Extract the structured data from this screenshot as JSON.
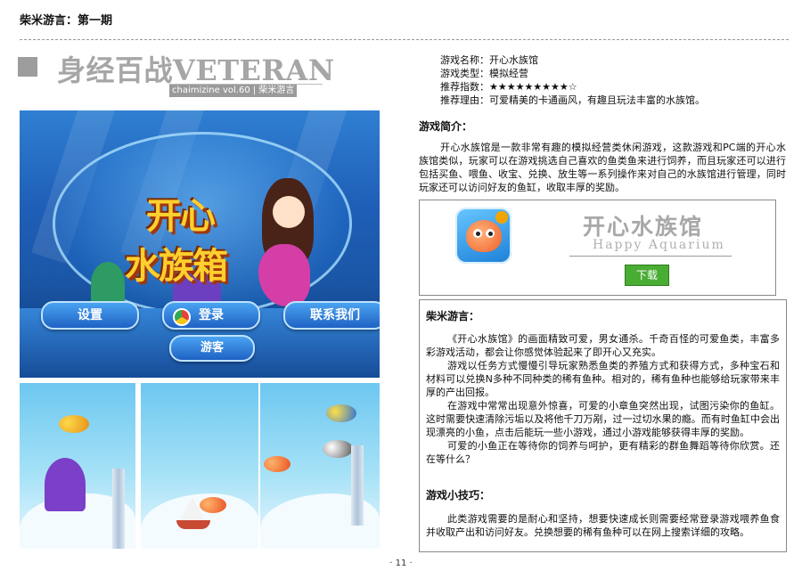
{
  "header": {
    "title": "柴米游言：第一期"
  },
  "column": {
    "title": "身经百战VETERAN",
    "subtitle": "chaimizine vol.60 | 柴米游言"
  },
  "game_info": {
    "name": "游戏名称：开心水族馆",
    "type": "游戏类型：模拟经营",
    "rating": "推荐指数：★★★★★★★★★☆",
    "reason": "推荐理由：可爱精美的卡通画风，有趣且玩法丰富的水族馆。"
  },
  "intro": {
    "heading": "游戏简介：",
    "text": "开心水族馆是一款非常有趣的模拟经营类休闲游戏，这款游戏和PC端的开心水族馆类似，玩家可以在游戏挑选自己喜欢的鱼类鱼来进行饲养，而且玩家还可以进行包括买鱼、喂鱼、收宝、兑换、放生等一系列操作来对自己的水族馆进行管理，同时玩家还可以访问好友的鱼缸，收取丰厚的奖励。"
  },
  "app_card": {
    "icon": "clownfish-app-icon",
    "title": "开心水族馆",
    "subtitle": "Happy  Aquarium",
    "download_label": "下载",
    "download_color": "#49ad34"
  },
  "review": {
    "heading": "柴米游言：",
    "paragraphs": [
      "《开心水族馆》的画面精致可爱，男女通杀。千奇百怪的可爱鱼类，丰富多彩游戏活动，都会让你感觉体验起来了即开心又充实。",
      "游戏以任务方式慢慢引导玩家熟悉鱼类的养殖方式和获得方式，多种宝石和材料可以兑换N多种不同种类的稀有鱼种。相对的，稀有鱼种也能够给玩家带来丰厚的产出回报。",
      "在游戏中常常出现意外惊喜，可爱的小章鱼突然出现，试图污染你的鱼缸。这时需要快速清除污垢以及将他千刀万剐，过一过切水果的瘾。而有时鱼缸中会出现漂亮的小鱼，点击后能玩一些小游戏，通过小游戏能够获得丰厚的奖励。",
      "可爱的小鱼正在等待你的饲养与呵护，更有精彩的群鱼舞蹈等待你欣赏。还在等什么？"
    ],
    "tips_heading": "游戏小技巧：",
    "tips_text": "此类游戏需要的是耐心和坚持，想要快速成长则需要经常登录游戏喂养鱼食并收取产出和访问好友。兑换想要的稀有鱼种可以在网上搜索详细的攻略。"
  },
  "game_screen": {
    "logo_line1": "开心",
    "logo_line2": "水族箱",
    "buttons": {
      "settings": "设置",
      "login": "登录",
      "contact": "联系我们",
      "guest": "游客"
    }
  },
  "page_number": "· 11 ·"
}
